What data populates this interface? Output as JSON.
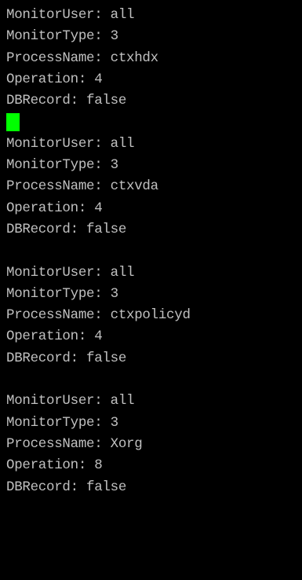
{
  "colors": {
    "background": "#000000",
    "text": "#c0c0c0",
    "cursor": "#00ff00"
  },
  "blocks": [
    {
      "monitor_user": "MonitorUser: all",
      "monitor_type": "MonitorType: 3",
      "process_name": "ProcessName: ctxhdx",
      "operation": "Operation: 4",
      "db_record": "DBRecord: false"
    },
    {
      "monitor_user": "MonitorUser: all",
      "monitor_type": "MonitorType: 3",
      "process_name": "ProcessName: ctxvda",
      "operation": "Operation: 4",
      "db_record": "DBRecord: false"
    },
    {
      "monitor_user": "MonitorUser: all",
      "monitor_type": "MonitorType: 3",
      "process_name": "ProcessName: ctxpolicyd",
      "operation": "Operation: 4",
      "db_record": "DBRecord: false"
    },
    {
      "monitor_user": "MonitorUser: all",
      "monitor_type": "MonitorType: 3",
      "process_name": "ProcessName: Xorg",
      "operation": "Operation: 8",
      "db_record": "DBRecord: false"
    }
  ]
}
